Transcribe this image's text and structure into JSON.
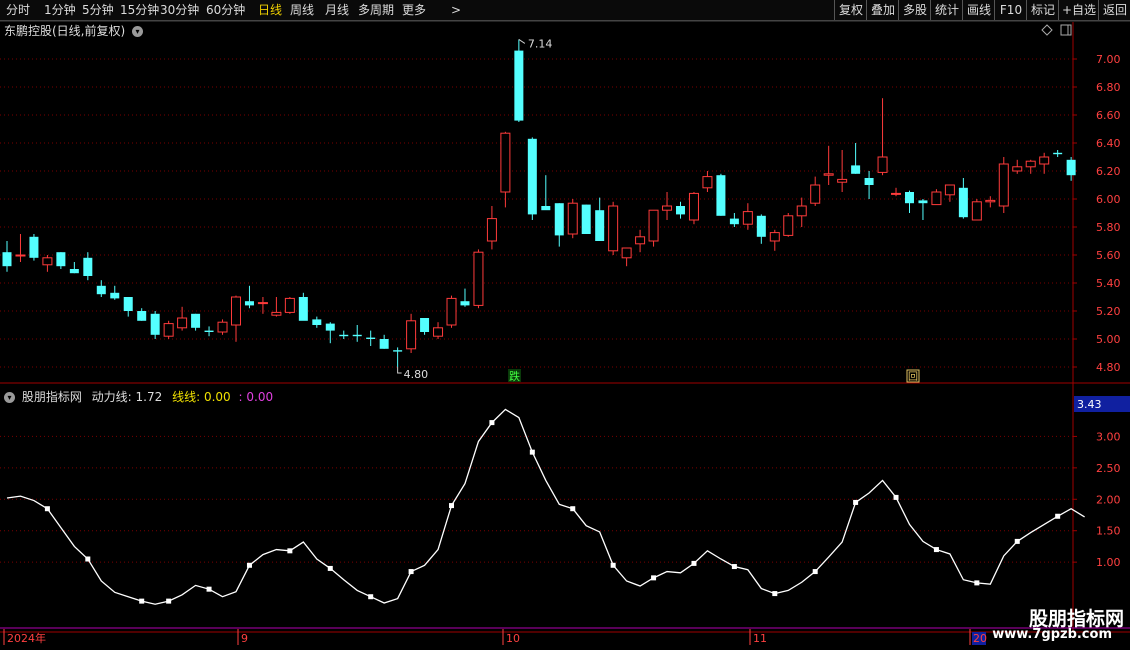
{
  "toolbar": {
    "periods": [
      "分时",
      "1分钟",
      "5分钟",
      "15分钟",
      "30分钟",
      "60分钟",
      "日线",
      "周线",
      "月线",
      "多周期",
      "更多"
    ],
    "active_period": "日线",
    "more_arrow": ">",
    "right_buttons": [
      "复权",
      "叠加",
      "多股",
      "统计",
      "画线",
      "F10",
      "标记",
      "+自选",
      "返回"
    ]
  },
  "price_panel": {
    "title": "东鹏控股(日线,前复权)",
    "max_label": "7.14",
    "min_label": "4.80",
    "signal_die": "跌",
    "signal_hui": "回",
    "y_ticks": [
      "7.00",
      "6.80",
      "6.60",
      "6.40",
      "6.20",
      "6.00",
      "5.80",
      "5.60",
      "5.40",
      "5.20",
      "5.00",
      "4.80"
    ]
  },
  "indicator_panel": {
    "name": "股朋指标网",
    "line1_label": "动力线:",
    "line1_value": "1.72",
    "line2_label": "线线:",
    "line2_value": "0.00",
    "line3_value": ": 0.00",
    "current_value": "3.43",
    "y_ticks": [
      "3.00",
      "2.50",
      "2.00",
      "1.50",
      "1.00"
    ]
  },
  "date_axis": {
    "labels": [
      "2024年",
      "9",
      "10",
      "11",
      "20"
    ]
  },
  "watermark": {
    "title": "股朋指标网",
    "url": "www.7gpzb.com"
  },
  "colors": {
    "up": "#ff3b3b",
    "down": "#54ffff",
    "grid": "#7a0000",
    "axis": "#a00000",
    "indicator_line": "#ffffff",
    "active": "#f0d000"
  },
  "chart_data": [
    {
      "type": "candlestick",
      "title": "东鹏控股(日线,前复权)",
      "ylim": [
        4.7,
        7.3
      ],
      "candles": [
        [
          5.62,
          5.7,
          5.48,
          5.52
        ],
        [
          5.6,
          5.75,
          5.55,
          5.6
        ],
        [
          5.73,
          5.75,
          5.56,
          5.58
        ],
        [
          5.53,
          5.6,
          5.48,
          5.58
        ],
        [
          5.62,
          5.62,
          5.5,
          5.52
        ],
        [
          5.5,
          5.55,
          5.47,
          5.47
        ],
        [
          5.58,
          5.62,
          5.42,
          5.45
        ],
        [
          5.38,
          5.42,
          5.3,
          5.32
        ],
        [
          5.33,
          5.38,
          5.28,
          5.29
        ],
        [
          5.3,
          5.3,
          5.16,
          5.2
        ],
        [
          5.2,
          5.22,
          5.13,
          5.13
        ],
        [
          5.18,
          5.2,
          5.0,
          5.03
        ],
        [
          5.02,
          5.13,
          5.0,
          5.11
        ],
        [
          5.08,
          5.23,
          5.06,
          5.15
        ],
        [
          5.18,
          5.18,
          5.06,
          5.08
        ],
        [
          5.06,
          5.09,
          5.02,
          5.05
        ],
        [
          5.05,
          5.14,
          5.03,
          5.12
        ],
        [
          5.1,
          5.31,
          4.98,
          5.3
        ],
        [
          5.27,
          5.38,
          5.22,
          5.24
        ],
        [
          5.26,
          5.3,
          5.18,
          5.26
        ],
        [
          5.17,
          5.3,
          5.16,
          5.19
        ],
        [
          5.19,
          5.3,
          5.18,
          5.29
        ],
        [
          5.3,
          5.33,
          5.14,
          5.13
        ],
        [
          5.14,
          5.16,
          5.08,
          5.1
        ],
        [
          5.11,
          5.12,
          4.97,
          5.06
        ],
        [
          5.03,
          5.06,
          5.0,
          5.02
        ],
        [
          5.03,
          5.1,
          4.98,
          5.02
        ],
        [
          5.01,
          5.06,
          4.95,
          5.0
        ],
        [
          5.0,
          5.03,
          4.93,
          4.93
        ],
        [
          4.92,
          4.94,
          4.8,
          4.91
        ],
        [
          4.93,
          5.18,
          4.9,
          5.13
        ],
        [
          5.15,
          5.15,
          5.03,
          5.05
        ],
        [
          5.02,
          5.12,
          5.0,
          5.08
        ],
        [
          5.1,
          5.31,
          5.08,
          5.29
        ],
        [
          5.27,
          5.36,
          5.23,
          5.24
        ],
        [
          5.24,
          5.64,
          5.22,
          5.62
        ],
        [
          5.7,
          5.95,
          5.64,
          5.86
        ],
        [
          6.05,
          6.48,
          5.94,
          6.47
        ],
        [
          7.06,
          7.14,
          6.55,
          6.56
        ],
        [
          6.43,
          6.44,
          5.85,
          5.89
        ],
        [
          5.95,
          6.17,
          5.94,
          5.92
        ],
        [
          5.97,
          5.97,
          5.66,
          5.74
        ],
        [
          5.75,
          6.0,
          5.72,
          5.97
        ],
        [
          5.96,
          5.96,
          5.75,
          5.75
        ],
        [
          5.92,
          6.01,
          5.7,
          5.7
        ],
        [
          5.63,
          5.98,
          5.6,
          5.95
        ],
        [
          5.58,
          5.65,
          5.52,
          5.65
        ],
        [
          5.68,
          5.78,
          5.62,
          5.73
        ],
        [
          5.7,
          5.92,
          5.66,
          5.92
        ],
        [
          5.92,
          6.05,
          5.85,
          5.95
        ],
        [
          5.95,
          5.98,
          5.86,
          5.89
        ],
        [
          5.85,
          6.05,
          5.82,
          6.04
        ],
        [
          6.08,
          6.2,
          6.05,
          6.16
        ],
        [
          6.17,
          6.18,
          5.88,
          5.88
        ],
        [
          5.86,
          5.9,
          5.8,
          5.82
        ],
        [
          5.82,
          5.97,
          5.78,
          5.91
        ],
        [
          5.88,
          5.89,
          5.68,
          5.73
        ],
        [
          5.7,
          5.78,
          5.63,
          5.76
        ],
        [
          5.74,
          5.9,
          5.73,
          5.88
        ],
        [
          5.88,
          6.01,
          5.8,
          5.95
        ],
        [
          5.97,
          6.16,
          5.95,
          6.1
        ],
        [
          6.17,
          6.38,
          6.1,
          6.18
        ],
        [
          6.12,
          6.35,
          6.05,
          6.14
        ],
        [
          6.24,
          6.4,
          6.18,
          6.18
        ],
        [
          6.15,
          6.2,
          6.0,
          6.1
        ],
        [
          6.19,
          6.72,
          6.17,
          6.3
        ],
        [
          6.04,
          6.08,
          6.02,
          6.04
        ],
        [
          6.05,
          6.06,
          5.9,
          5.97
        ],
        [
          5.99,
          6.0,
          5.85,
          5.97
        ],
        [
          5.96,
          6.07,
          5.96,
          6.05
        ],
        [
          6.03,
          6.1,
          5.98,
          6.1
        ],
        [
          6.08,
          6.15,
          5.86,
          5.87
        ],
        [
          5.85,
          6.0,
          5.85,
          5.98
        ],
        [
          5.98,
          6.02,
          5.94,
          5.99
        ],
        [
          5.95,
          6.3,
          5.9,
          6.25
        ],
        [
          6.2,
          6.28,
          6.18,
          6.23
        ],
        [
          6.23,
          6.28,
          6.18,
          6.27
        ],
        [
          6.25,
          6.33,
          6.18,
          6.3
        ],
        [
          6.33,
          6.35,
          6.3,
          6.32
        ],
        [
          6.28,
          6.3,
          6.13,
          6.17
        ]
      ],
      "annotations": [
        {
          "label": "7.14",
          "type": "max"
        },
        {
          "label": "4.80",
          "type": "min"
        },
        {
          "label": "跌"
        },
        {
          "label": "回"
        }
      ]
    },
    {
      "type": "line",
      "title": "股朋指标网",
      "ylim": [
        0.0,
        3.5
      ],
      "series": [
        {
          "name": "动力线",
          "values": [
            2.02,
            2.05,
            1.98,
            1.85,
            1.55,
            1.25,
            1.05,
            0.7,
            0.52,
            0.45,
            0.38,
            0.33,
            0.38,
            0.48,
            0.63,
            0.57,
            0.45,
            0.53,
            0.95,
            1.12,
            1.2,
            1.18,
            1.32,
            1.05,
            0.9,
            0.72,
            0.55,
            0.45,
            0.35,
            0.42,
            0.85,
            0.95,
            1.2,
            1.9,
            2.25,
            2.92,
            3.22,
            3.43,
            3.3,
            2.75,
            2.3,
            1.92,
            1.85,
            1.58,
            1.48,
            0.95,
            0.7,
            0.62,
            0.75,
            0.85,
            0.83,
            0.98,
            1.18,
            1.05,
            0.93,
            0.88,
            0.58,
            0.5,
            0.55,
            0.68,
            0.85,
            1.08,
            1.32,
            1.95,
            2.1,
            2.3,
            2.03,
            1.6,
            1.33,
            1.2,
            1.13,
            0.72,
            0.67,
            0.65,
            1.1,
            1.33,
            1.47,
            1.6,
            1.73,
            1.85,
            1.72
          ],
          "markers": [
            3,
            6,
            10,
            12,
            15,
            18,
            21,
            24,
            27,
            30,
            33,
            36,
            39,
            42,
            45,
            48,
            51,
            54,
            57,
            60,
            63,
            66,
            69,
            72,
            75,
            78
          ]
        }
      ]
    }
  ]
}
